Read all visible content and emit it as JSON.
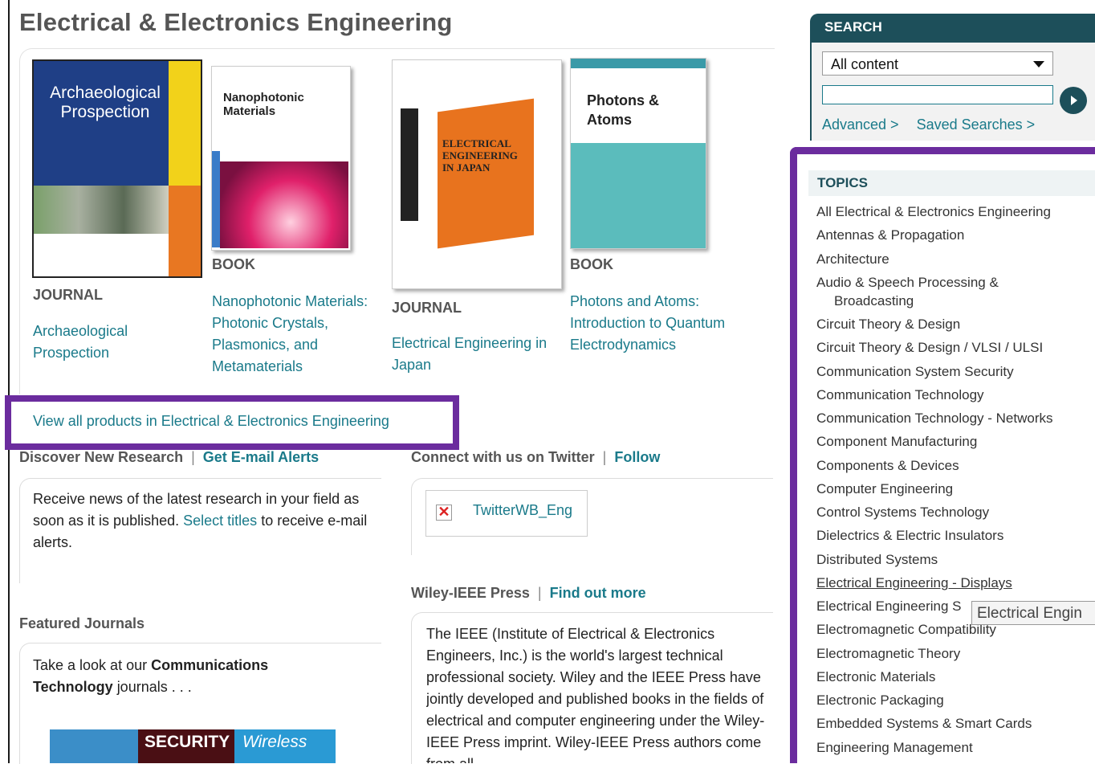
{
  "page_title": "Electrical & Electronics Engineering",
  "products": [
    {
      "type": "JOURNAL",
      "title": "Archaeological Prospection",
      "cover_title": "Archaeological Prospection"
    },
    {
      "type": "BOOK",
      "title": "Nanophotonic Materials: Photonic Crystals, Plasmonics, and Metamaterials",
      "cover_title": "Nanophotonic Materials"
    },
    {
      "type": "JOURNAL",
      "title": "Electrical Engineering in Japan",
      "cover_title": "ELECTRICAL ENGINEERING IN JAPAN"
    },
    {
      "type": "BOOK",
      "title": "Photons and Atoms: Introduction to Quantum Electrodynamics",
      "cover_title": "Photons & Atoms"
    }
  ],
  "view_all_link": "View all products in Electrical & Electronics Engineering",
  "discover": {
    "heading": "Discover New Research",
    "sep": "|",
    "action": "Get E-mail Alerts",
    "text_before": "Receive news of the latest research in your field as soon as it is published.",
    "link": "Select titles",
    "text_after": "to receive e-mail alerts."
  },
  "twitter": {
    "heading": "Connect with us on Twitter",
    "sep": "|",
    "action": "Follow",
    "widget_label": "TwitterWB_Eng"
  },
  "featured": {
    "heading": "Featured Journals",
    "text_before": "Take a look at our",
    "bold": "Communications Technology",
    "text_after": "journals . . .",
    "image_words": [
      "SECURITY",
      "Wireless"
    ]
  },
  "press": {
    "heading": "Wiley-IEEE Press",
    "sep": "|",
    "action": "Find out more",
    "text": "The IEEE (Institute of Electrical & Electronics Engineers, Inc.) is the world's largest technical professional society. Wiley and the IEEE Press have jointly developed and published books in the fields of electrical and computer engineering under the Wiley-IEEE Press imprint. Wiley-IEEE Press authors come from all"
  },
  "search": {
    "heading": "SEARCH",
    "scope": "All content",
    "advanced": "Advanced >",
    "saved": "Saved Searches >"
  },
  "topics": {
    "heading": "TOPICS",
    "items": [
      "All Electrical & Electronics Engineering",
      "Antennas & Propagation",
      "Architecture",
      "Audio & Speech Processing &",
      "Broadcasting",
      "Circuit Theory & Design",
      "Circuit Theory & Design / VLSI / ULSI",
      "Communication System Security",
      "Communication Technology",
      "Communication Technology - Networks",
      "Component Manufacturing",
      "Components & Devices",
      "Computer Engineering",
      "Control Systems Technology",
      "Dielectrics & Electric Insulators",
      "Distributed Systems",
      "Electrical Engineering - Displays",
      "Electrical Engineering S",
      "Electromagnetic Compatibility",
      "Electromagnetic Theory",
      "Electronic Materials",
      "Electronic Packaging",
      "Embedded Systems & Smart Cards",
      "Engineering Management"
    ],
    "tooltip": "Electrical Engin"
  },
  "colors": {
    "accent": "#1a7a8a",
    "highlight": "#6b2c9e",
    "panel": "#1d4f5a"
  }
}
